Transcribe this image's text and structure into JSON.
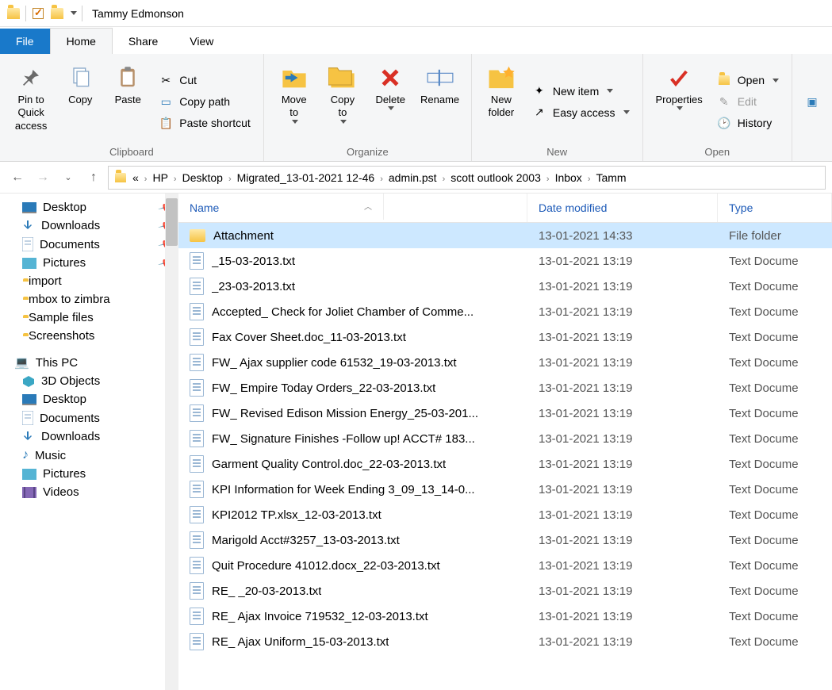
{
  "title": "Tammy Edmonson",
  "tabs": {
    "file": "File",
    "home": "Home",
    "share": "Share",
    "view": "View"
  },
  "ribbon": {
    "clipboard": {
      "label": "Clipboard",
      "pin": "Pin to Quick access",
      "copy": "Copy",
      "paste": "Paste",
      "cut": "Cut",
      "copypath": "Copy path",
      "pasteshort": "Paste shortcut"
    },
    "organize": {
      "label": "Organize",
      "moveto": "Move to",
      "copyto": "Copy to",
      "delete": "Delete",
      "rename": "Rename"
    },
    "new": {
      "label": "New",
      "newfolder": "New folder",
      "newitem": "New item",
      "easyaccess": "Easy access"
    },
    "open": {
      "label": "Open",
      "properties": "Properties",
      "open": "Open",
      "edit": "Edit",
      "history": "History"
    }
  },
  "breadcrumbs": [
    "«",
    "HP",
    "Desktop",
    "Migrated_13-01-2021 12-46",
    "admin.pst",
    "scott outlook 2003",
    "Inbox",
    "Tamm"
  ],
  "tree": {
    "quick": [
      {
        "icon": "desktop",
        "label": "Desktop",
        "pin": true
      },
      {
        "icon": "downloads",
        "label": "Downloads",
        "pin": true
      },
      {
        "icon": "documents",
        "label": "Documents",
        "pin": true
      },
      {
        "icon": "pictures",
        "label": "Pictures",
        "pin": true
      },
      {
        "icon": "folder",
        "label": "import"
      },
      {
        "icon": "folder",
        "label": "mbox to zimbra"
      },
      {
        "icon": "folder",
        "label": "Sample files"
      },
      {
        "icon": "folder",
        "label": "Screenshots"
      }
    ],
    "thispc_label": "This PC",
    "thispc": [
      {
        "icon": "3d",
        "label": "3D Objects"
      },
      {
        "icon": "desktop",
        "label": "Desktop"
      },
      {
        "icon": "documents",
        "label": "Documents"
      },
      {
        "icon": "downloads",
        "label": "Downloads"
      },
      {
        "icon": "music",
        "label": "Music"
      },
      {
        "icon": "pictures",
        "label": "Pictures"
      },
      {
        "icon": "videos",
        "label": "Videos"
      }
    ]
  },
  "columns": {
    "name": "Name",
    "date": "Date modified",
    "type": "Type"
  },
  "rows": [
    {
      "icon": "folder",
      "name": "Attachment",
      "date": "13-01-2021 14:33",
      "type": "File folder",
      "sel": true
    },
    {
      "icon": "file",
      "name": "_15-03-2013.txt",
      "date": "13-01-2021 13:19",
      "type": "Text Docume"
    },
    {
      "icon": "file",
      "name": "_23-03-2013.txt",
      "date": "13-01-2021 13:19",
      "type": "Text Docume"
    },
    {
      "icon": "file",
      "name": "Accepted_ Check for Joliet Chamber of Comme...",
      "date": "13-01-2021 13:19",
      "type": "Text Docume"
    },
    {
      "icon": "file",
      "name": "Fax Cover Sheet.doc_11-03-2013.txt",
      "date": "13-01-2021 13:19",
      "type": "Text Docume"
    },
    {
      "icon": "file",
      "name": "FW_ Ajax supplier code 61532_19-03-2013.txt",
      "date": "13-01-2021 13:19",
      "type": "Text Docume"
    },
    {
      "icon": "file",
      "name": "FW_ Empire Today Orders_22-03-2013.txt",
      "date": "13-01-2021 13:19",
      "type": "Text Docume"
    },
    {
      "icon": "file",
      "name": "FW_ Revised Edison Mission Energy_25-03-201...",
      "date": "13-01-2021 13:19",
      "type": "Text Docume"
    },
    {
      "icon": "file",
      "name": "FW_ Signature Finishes -Follow up! ACCT# 183...",
      "date": "13-01-2021 13:19",
      "type": "Text Docume"
    },
    {
      "icon": "file",
      "name": "Garment Quality Control.doc_22-03-2013.txt",
      "date": "13-01-2021 13:19",
      "type": "Text Docume"
    },
    {
      "icon": "file",
      "name": "KPI Information for Week Ending 3_09_13_14-0...",
      "date": "13-01-2021 13:19",
      "type": "Text Docume"
    },
    {
      "icon": "file",
      "name": "KPI2012 TP.xlsx_12-03-2013.txt",
      "date": "13-01-2021 13:19",
      "type": "Text Docume"
    },
    {
      "icon": "file",
      "name": "Marigold Acct#3257_13-03-2013.txt",
      "date": "13-01-2021 13:19",
      "type": "Text Docume"
    },
    {
      "icon": "file",
      "name": "Quit Procedure 41012.docx_22-03-2013.txt",
      "date": "13-01-2021 13:19",
      "type": "Text Docume"
    },
    {
      "icon": "file",
      "name": "RE_ _20-03-2013.txt",
      "date": "13-01-2021 13:19",
      "type": "Text Docume"
    },
    {
      "icon": "file",
      "name": "RE_ Ajax Invoice 719532_12-03-2013.txt",
      "date": "13-01-2021 13:19",
      "type": "Text Docume"
    },
    {
      "icon": "file",
      "name": "RE_ Ajax Uniform_15-03-2013.txt",
      "date": "13-01-2021 13:19",
      "type": "Text Docume"
    }
  ]
}
